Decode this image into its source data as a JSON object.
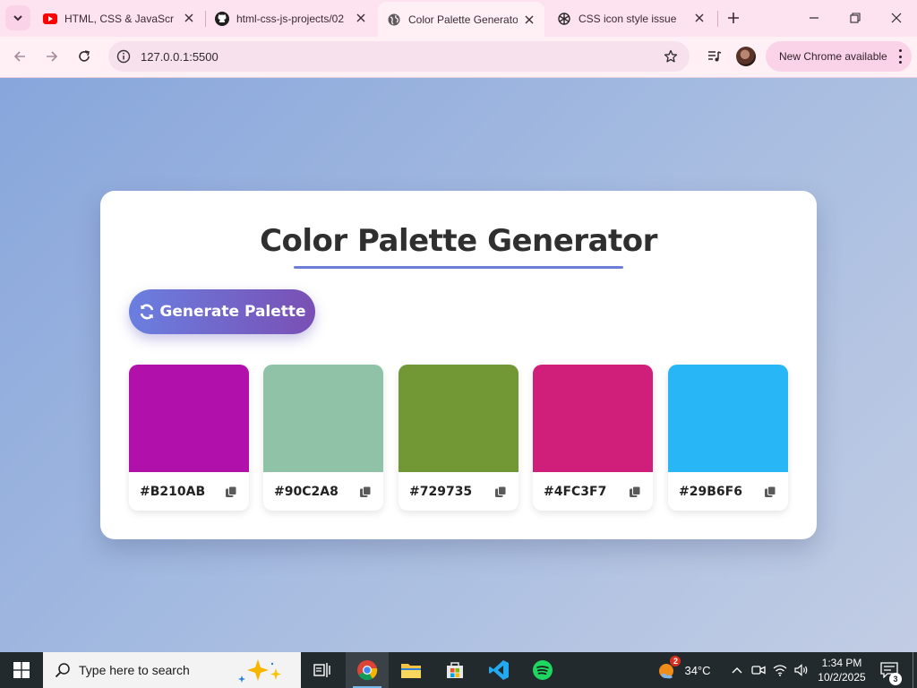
{
  "browser": {
    "tabs": [
      {
        "title": "HTML, CSS & JavaScript",
        "favicon": "youtube-icon",
        "active": false
      },
      {
        "title": "html-css-js-projects/02",
        "favicon": "github-icon",
        "active": false
      },
      {
        "title": "Color Palette Generator",
        "favicon": "globe-icon",
        "active": true
      },
      {
        "title": "CSS icon style issue",
        "favicon": "chatgpt-icon",
        "active": false
      }
    ],
    "url": "127.0.0.1:5500",
    "update_label": "New Chrome available",
    "colors": {
      "tabstrip": "#fde3f0",
      "toolbar": "#fff0f6",
      "omnibox": "#f6e1ec"
    }
  },
  "page": {
    "title": "Color Palette Generator",
    "generate_label": "Generate Palette",
    "palette": [
      {
        "hex": "#B210AB",
        "color": "#B210AB"
      },
      {
        "hex": "#90C2A8",
        "color": "#90C2A8"
      },
      {
        "hex": "#729735",
        "color": "#729735"
      },
      {
        "hex": "#4FC3F7",
        "color": "#D01F7A"
      },
      {
        "hex": "#29B6F6",
        "color": "#29B6F6"
      }
    ],
    "colors": {
      "accent": "#6c7fd8",
      "button_start": "#6a7fe0",
      "button_end": "#7a4fb4",
      "text": "#2f2f2f"
    }
  },
  "taskbar": {
    "search_placeholder": "Type here to search",
    "weather_temp": "34°C",
    "weather_badge": "2",
    "time": "1:34 PM",
    "date": "10/2/2025",
    "notification_count": "3",
    "apps": [
      "task-view-icon",
      "chrome-icon",
      "file-explorer-icon",
      "microsoft-store-icon",
      "vscode-icon",
      "spotify-icon"
    ]
  }
}
